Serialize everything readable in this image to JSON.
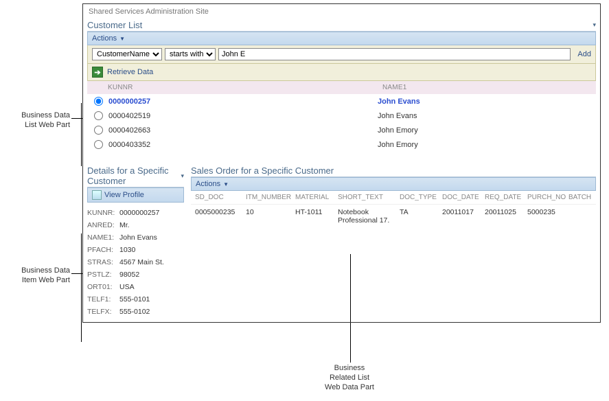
{
  "site_title": "Shared Services Administration Site",
  "annotations": {
    "list": "Business Data\nList Web Part",
    "item": "Business Data\nItem Web Part",
    "related": "Business\nRelated List\nWeb Data Part"
  },
  "customer_list": {
    "title": "Customer List",
    "actions_label": "Actions",
    "filter": {
      "field_options": [
        "CustomerName"
      ],
      "field_selected": "CustomerName",
      "op_options": [
        "starts with"
      ],
      "op_selected": "starts with",
      "value": "John E",
      "add_label": "Add"
    },
    "retrieve_label": "Retrieve Data",
    "columns": {
      "kunnr": "KUNNR",
      "name1": "NAME1"
    },
    "rows": [
      {
        "kunnr": "0000000257",
        "name1": "John Evans",
        "selected": true
      },
      {
        "kunnr": "0000402519",
        "name1": "John Evans",
        "selected": false
      },
      {
        "kunnr": "0000402663",
        "name1": "John Emory",
        "selected": false
      },
      {
        "kunnr": "0000403352",
        "name1": "John Emory",
        "selected": false
      }
    ]
  },
  "details": {
    "title": "Details for a Specific Customer",
    "view_profile_label": "View Profile",
    "fields": [
      {
        "k": "KUNNR:",
        "v": "0000000257"
      },
      {
        "k": "ANRED:",
        "v": "Mr."
      },
      {
        "k": "NAME1:",
        "v": "John Evans"
      },
      {
        "k": "PFACH:",
        "v": "1030"
      },
      {
        "k": "STRAS:",
        "v": "4567 Main St."
      },
      {
        "k": "PSTLZ:",
        "v": "98052"
      },
      {
        "k": "ORT01:",
        "v": "USA"
      },
      {
        "k": "TELF1:",
        "v": "555-0101"
      },
      {
        "k": "TELFX:",
        "v": "555-0102"
      }
    ]
  },
  "sales_order": {
    "title": "Sales Order for a Specific Customer",
    "actions_label": "Actions",
    "columns": [
      "SD_DOC",
      "ITM_NUMBER",
      "MATERIAL",
      "SHORT_TEXT",
      "DOC_TYPE",
      "DOC_DATE",
      "REQ_DATE",
      "PURCH_NO",
      "BATCH"
    ],
    "rows": [
      {
        "sd_doc": "0005000235",
        "itm_number": "10",
        "material": "HT-1011",
        "short_text": "Notebook Professional 17.",
        "doc_type": "TA",
        "doc_date": "20011017",
        "req_date": "20011025",
        "purch_no": "5000235",
        "batch": ""
      }
    ]
  }
}
